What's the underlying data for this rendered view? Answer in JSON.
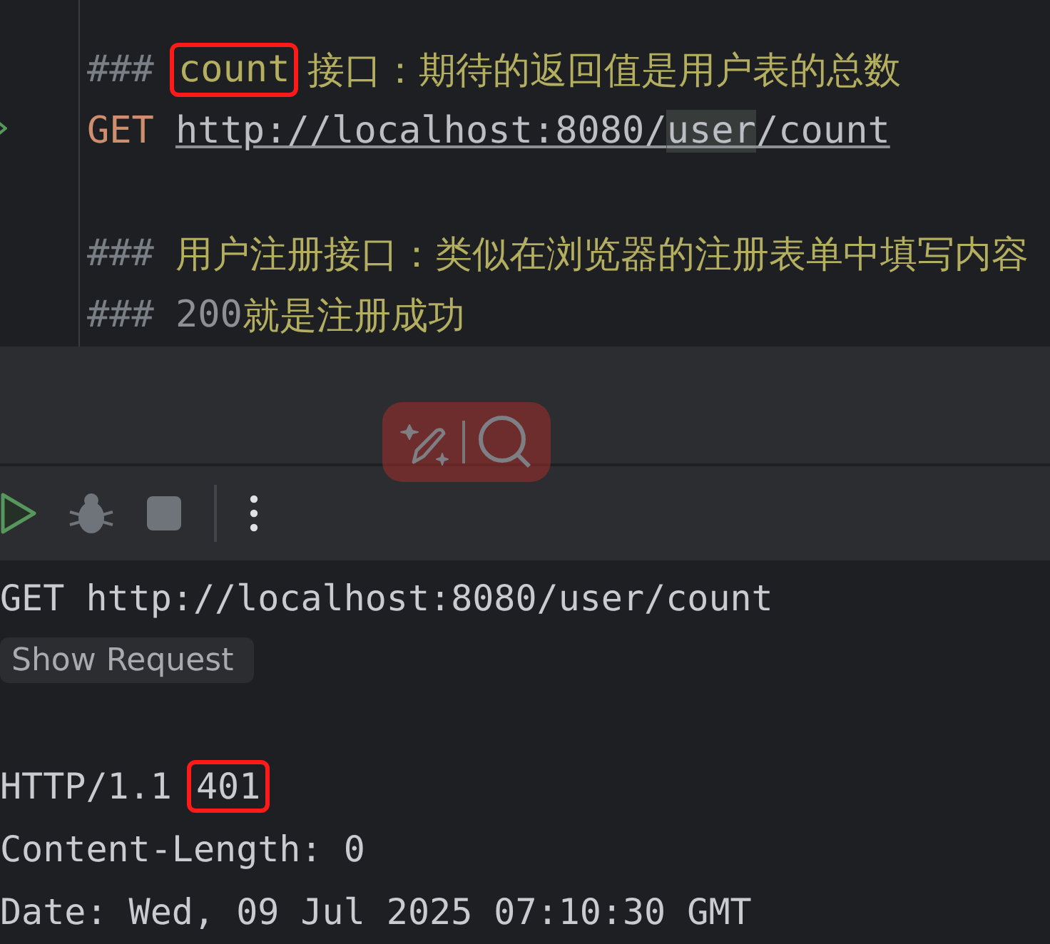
{
  "editor": {
    "lines": [
      {
        "kind": "blank"
      },
      {
        "kind": "comment",
        "prefix": "###",
        "parts": [
          {
            "text": "count",
            "boxed": true,
            "kind": "word"
          },
          {
            "text": "接口：期待的返回值是用户表的总数",
            "boxed": false,
            "kind": "word"
          }
        ]
      },
      {
        "kind": "request",
        "run_marker": true,
        "method": "GET",
        "url_parts": [
          {
            "text": "http://localhost:8080/",
            "word_highlight": false
          },
          {
            "text": "user",
            "word_highlight": true
          },
          {
            "text": "/count",
            "word_highlight": false
          }
        ]
      },
      {
        "kind": "blank"
      },
      {
        "kind": "comment",
        "prefix": "###",
        "parts": [
          {
            "text": "用户注册接口：类似在浏览器的注册表单中填写内容",
            "boxed": false,
            "kind": "word"
          }
        ]
      },
      {
        "kind": "comment",
        "prefix": "###",
        "parts": [
          {
            "text": "200",
            "boxed": false,
            "kind": "number"
          },
          {
            "text": "就是注册成功",
            "boxed": false,
            "kind": "word"
          }
        ]
      }
    ]
  },
  "run_toolbar": {
    "buttons": [
      {
        "kind": "run",
        "disabled": false
      },
      {
        "kind": "debug",
        "disabled": true
      },
      {
        "kind": "stop",
        "disabled": true
      },
      {
        "kind": "more",
        "disabled": false
      }
    ]
  },
  "floating_toolbar": {
    "buttons": [
      {
        "kind": "ai-edit"
      },
      {
        "kind": "search"
      }
    ]
  },
  "response": {
    "lines": [
      {
        "kind": "text",
        "parts": [
          {
            "text": "GET http://localhost:8080/user/count",
            "boxed": false
          }
        ]
      },
      {
        "kind": "button",
        "label": "Show Request"
      },
      {
        "kind": "blank"
      },
      {
        "kind": "text",
        "parts": [
          {
            "text": "HTTP/1.1 ",
            "boxed": false
          },
          {
            "text": "401",
            "boxed": true
          }
        ]
      },
      {
        "kind": "text",
        "parts": [
          {
            "text": "Content-Length: 0",
            "boxed": false
          }
        ]
      },
      {
        "kind": "text",
        "parts": [
          {
            "text": "Date: Wed, 09 Jul 2025 07:10:30 GMT",
            "boxed": false
          }
        ]
      }
    ]
  }
}
